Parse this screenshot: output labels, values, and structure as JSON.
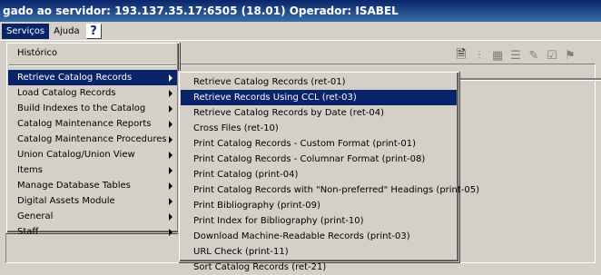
{
  "window": {
    "title": "gado ao servidor:  193.137.35.17:6505 (18.01)  Operador:  ISABEL"
  },
  "menubar": {
    "items": [
      "Serviços",
      "Ajuda"
    ],
    "help_glyph": "?"
  },
  "main_menu": {
    "first": "Histórico",
    "items": [
      {
        "label": "Retrieve Catalog Records",
        "submenu": true,
        "highlighted": true
      },
      {
        "label": "Load Catalog Records",
        "submenu": true
      },
      {
        "label": "Build Indexes to the Catalog",
        "submenu": true
      },
      {
        "label": "Catalog Maintenance Reports",
        "submenu": true
      },
      {
        "label": "Catalog Maintenance Procedures",
        "submenu": true
      },
      {
        "label": "Union Catalog/Union View",
        "submenu": true
      },
      {
        "label": "Items",
        "submenu": true
      },
      {
        "label": "Manage Database Tables",
        "submenu": true
      },
      {
        "label": "Digital Assets Module",
        "submenu": true
      },
      {
        "label": "General",
        "submenu": true
      },
      {
        "label": "Staff",
        "submenu": true
      }
    ]
  },
  "sub_menu": {
    "items": [
      "Retrieve Catalog Records (ret-01)",
      "Retrieve Records Using CCL (ret-03)",
      "Retrieve Catalog Records by Date (ret-04)",
      "Cross Files (ret-10)",
      "Print Catalog Records - Custom Format (print-01)",
      "Print Catalog Records - Columnar Format (print-08)",
      "Print Catalog (print-04)",
      "Print Catalog Records with \"Non-preferred\" Headings (print-05)",
      "Print Bibliography (print-09)",
      "Print Index for Bibliography (print-10)",
      "Download Machine-Readable Records (print-03)",
      "URL Check (print-11)",
      "Sort Catalog Records (ret-21)"
    ],
    "highlighted_index": 1
  },
  "toolbar": {
    "icons": [
      "new-record-icon",
      "tree-icon",
      "grid-icon",
      "list-icon",
      "tool-icon",
      "checkbox-icon",
      "flag-icon"
    ]
  },
  "colors": {
    "highlight": "#0a246a",
    "face": "#d4d0c8"
  }
}
